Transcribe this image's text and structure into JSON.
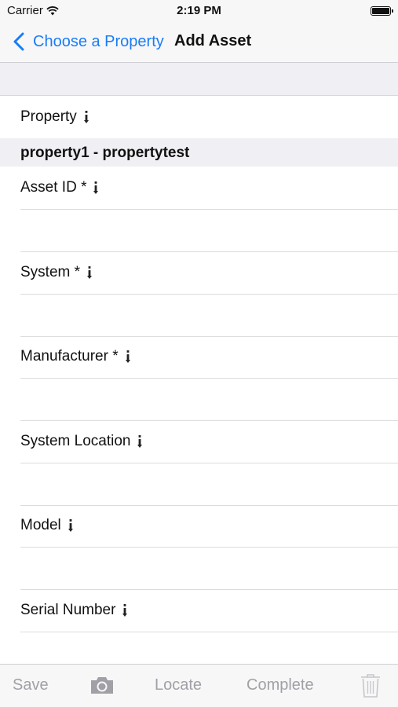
{
  "status_bar": {
    "carrier": "Carrier",
    "time": "2:19 PM"
  },
  "nav": {
    "back_label": "Choose a Property",
    "title": "Add Asset"
  },
  "form": {
    "property_label": "Property",
    "selected_property": "property1 - propertytest",
    "fields": [
      {
        "label": "Asset ID *",
        "value": ""
      },
      {
        "label": "System *",
        "value": ""
      },
      {
        "label": "Manufacturer *",
        "value": ""
      },
      {
        "label": "System Location",
        "value": ""
      },
      {
        "label": "Model",
        "value": ""
      },
      {
        "label": "Serial Number",
        "value": ""
      }
    ]
  },
  "toolbar": {
    "save_label": "Save",
    "camera_icon": "camera-icon",
    "locate_label": "Locate",
    "complete_label": "Complete",
    "trash_icon": "trash-icon",
    "disabled_color": "#a0a0a6"
  },
  "colors": {
    "accent": "#1a7cf6",
    "section_background": "#efeff4"
  }
}
